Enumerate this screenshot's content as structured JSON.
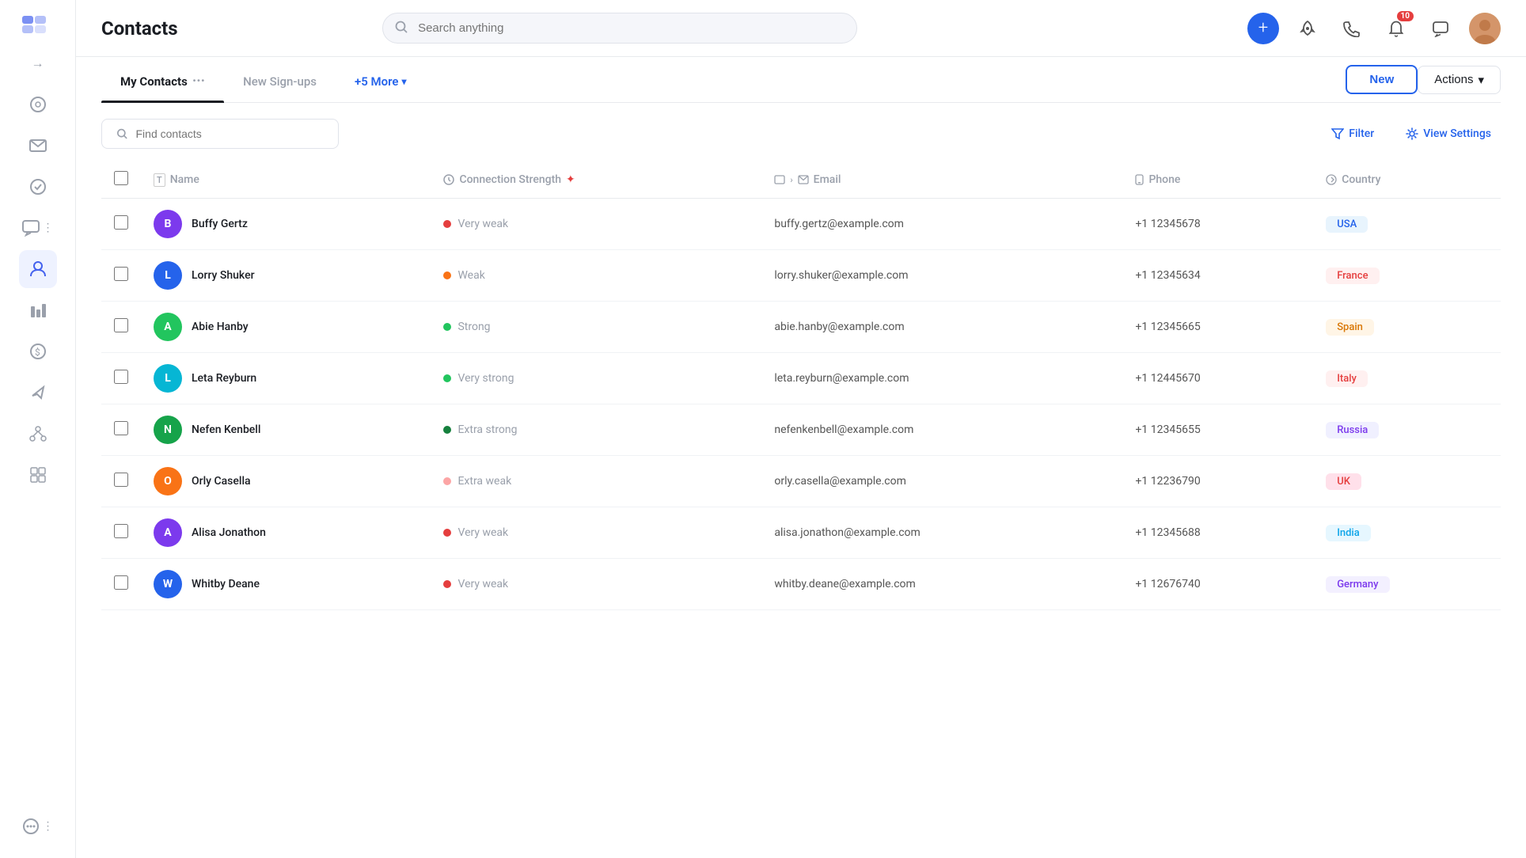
{
  "page": {
    "title": "Contacts"
  },
  "header": {
    "search_placeholder": "Search anything",
    "new_label": "New",
    "actions_label": "Actions",
    "notification_count": "10"
  },
  "tabs": [
    {
      "id": "my-contacts",
      "label": "My Contacts",
      "active": true
    },
    {
      "id": "new-signups",
      "label": "New Sign-ups",
      "active": false
    }
  ],
  "tabs_more": "+5 More",
  "filter": {
    "placeholder": "Find contacts",
    "filter_label": "Filter",
    "view_settings_label": "View Settings"
  },
  "table": {
    "columns": [
      {
        "id": "name",
        "label": "Name"
      },
      {
        "id": "connection-strength",
        "label": "Connection Strength"
      },
      {
        "id": "email",
        "label": "Email"
      },
      {
        "id": "phone",
        "label": "Phone"
      },
      {
        "id": "country",
        "label": "Country"
      }
    ],
    "rows": [
      {
        "id": 1,
        "name": "Buffy Gertz",
        "initial": "B",
        "avatar_color": "#7c3aed",
        "strength": "Very weak",
        "strength_color": "#e53e3e",
        "email": "buffy.gertz@example.com",
        "phone": "+1 12345678",
        "country": "USA",
        "country_class": "cb-usa"
      },
      {
        "id": 2,
        "name": "Lorry Shuker",
        "initial": "L",
        "avatar_color": "#2563eb",
        "strength": "Weak",
        "strength_color": "#f97316",
        "email": "lorry.shuker@example.com",
        "phone": "+1 12345634",
        "country": "France",
        "country_class": "cb-france"
      },
      {
        "id": 3,
        "name": "Abie Hanby",
        "initial": "A",
        "avatar_color": "#22c55e",
        "strength": "Strong",
        "strength_color": "#22c55e",
        "email": "abie.hanby@example.com",
        "phone": "+1 12345665",
        "country": "Spain",
        "country_class": "cb-spain"
      },
      {
        "id": 4,
        "name": "Leta Reyburn",
        "initial": "L",
        "avatar_color": "#06b6d4",
        "strength": "Very strong",
        "strength_color": "#22c55e",
        "email": "leta.reyburn@example.com",
        "phone": "+1 12445670",
        "country": "Italy",
        "country_class": "cb-italy"
      },
      {
        "id": 5,
        "name": "Nefen Kenbell",
        "initial": "N",
        "avatar_color": "#16a34a",
        "strength": "Extra strong",
        "strength_color": "#15803d",
        "email": "nefenkenbell@example.com",
        "phone": "+1 12345655",
        "country": "Russia",
        "country_class": "cb-russia"
      },
      {
        "id": 6,
        "name": "Orly Casella",
        "initial": "O",
        "avatar_color": "#f97316",
        "strength": "Extra weak",
        "strength_color": "#fca5a5",
        "email": "orly.casella@example.com",
        "phone": "+1 12236790",
        "country": "UK",
        "country_class": "cb-uk"
      },
      {
        "id": 7,
        "name": "Alisa Jonathon",
        "initial": "A",
        "avatar_color": "#7c3aed",
        "strength": "Very weak",
        "strength_color": "#e53e3e",
        "email": "alisa.jonathon@example.com",
        "phone": "+1 12345688",
        "country": "India",
        "country_class": "cb-india"
      },
      {
        "id": 8,
        "name": "Whitby Deane",
        "initial": "W",
        "avatar_color": "#2563eb",
        "strength": "Very weak",
        "strength_color": "#e53e3e",
        "email": "whitby.deane@example.com",
        "phone": "+1 12676740",
        "country": "Germany",
        "country_class": "cb-germany"
      }
    ]
  },
  "sidebar": {
    "items": [
      {
        "id": "dashboard",
        "icon": "⊙",
        "active": false
      },
      {
        "id": "mail",
        "icon": "✉",
        "active": false
      },
      {
        "id": "tasks",
        "icon": "◎",
        "active": false
      },
      {
        "id": "chat",
        "icon": "⬜",
        "active": false
      },
      {
        "id": "contacts",
        "icon": "👤",
        "active": true
      },
      {
        "id": "grid",
        "icon": "▦",
        "active": false
      },
      {
        "id": "dollar",
        "icon": "＄",
        "active": false
      },
      {
        "id": "megaphone",
        "icon": "📣",
        "active": false
      },
      {
        "id": "network",
        "icon": "⊕",
        "active": false
      },
      {
        "id": "widgets",
        "icon": "⊞",
        "active": false
      },
      {
        "id": "more",
        "icon": "⊙",
        "active": false
      }
    ]
  }
}
